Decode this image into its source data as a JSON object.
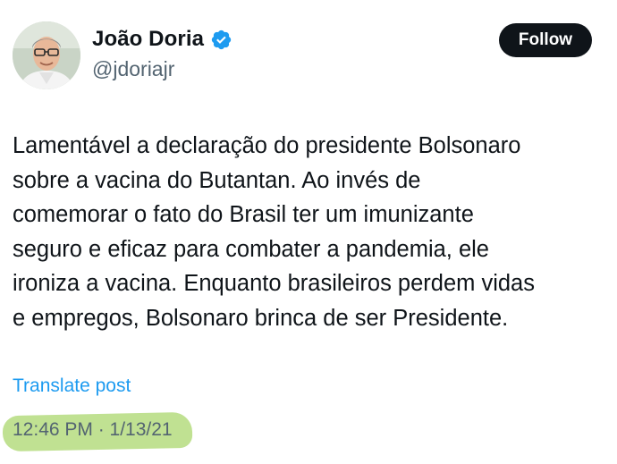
{
  "author": {
    "display_name": "João Doria",
    "handle": "@jdoriajr",
    "verified_icon": "verified-badge-icon",
    "verified_color": "#1d9bf0"
  },
  "follow_button": {
    "label": "Follow"
  },
  "post": {
    "lines": [
      "Lamentável a declaração do presidente Bolsonaro",
      "sobre a vacina do Butantan. Ao invés de",
      "comemorar o fato do Brasil ter um imunizante",
      "seguro e eficaz para combater a pandemia, ele",
      "ironiza a vacina. Enquanto brasileiros perdem vidas",
      "e empregos, Bolsonaro brinca de ser Presidente."
    ]
  },
  "translate": {
    "label": "Translate post"
  },
  "timestamp": {
    "text": "12:46 PM · 1/13/21",
    "highlight_color": "#b5dc7f"
  },
  "colors": {
    "text": "#0f1419",
    "secondary": "#536471",
    "link": "#1d9bf0",
    "button_bg": "#0f1419"
  }
}
